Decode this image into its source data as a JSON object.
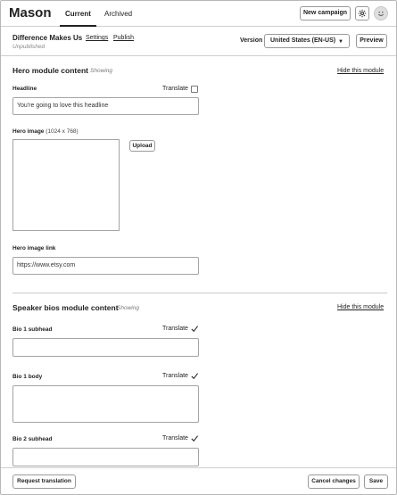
{
  "app": {
    "title": "Mason"
  },
  "nav": {
    "tabs": [
      {
        "label": "Current"
      },
      {
        "label": "Archived"
      }
    ]
  },
  "topbar": {
    "new_campaign_label": "New campaign",
    "settings_icon": "gear-icon",
    "avatar_icon": "smiley-face-icon"
  },
  "campaign": {
    "title": "Difference Makes Us",
    "settings_link": "Settings",
    "publish_link": "Publish",
    "status": "Unpublished",
    "version_label": "Version",
    "version_value": "United States (EN-US)",
    "preview_label": "Preview"
  },
  "hero_module": {
    "title": "Hero module content",
    "status": "Showing",
    "hide_link": "Hide this module",
    "headline_label": "Headline",
    "translate_label": "Translate",
    "translate_checked": false,
    "headline_value": "You're going to love this headline",
    "image_label": "Hero image",
    "image_dims": "(1024 x 768)",
    "upload_label": "Upload",
    "image_link_label": "Hero image link",
    "image_link_value": "https://www.etsy.com"
  },
  "speaker_module": {
    "title": "Speaker bios module content",
    "status": "Showing",
    "hide_link": "Hide this module",
    "fields": [
      {
        "label": "Bio 1 subhead",
        "translate_label": "Translate",
        "translate_checked": true,
        "value": ""
      },
      {
        "label": "Bio 1 body",
        "translate_label": "Translate",
        "translate_checked": true,
        "value": ""
      },
      {
        "label": "Bio 2 subhead",
        "translate_label": "Translate",
        "translate_checked": true,
        "value": ""
      }
    ]
  },
  "footer": {
    "request_translation_label": "Request translation",
    "cancel_label": "Cancel changes",
    "save_label": "Save"
  }
}
